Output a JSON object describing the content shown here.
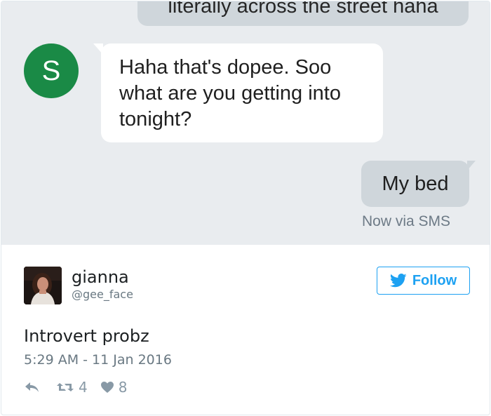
{
  "sms": {
    "cut_message": "literally across the street haha",
    "avatar_letter": "S",
    "incoming_message": "Haha that's dopee. Soo what are you getting into tonight?",
    "outgoing_message": "My bed",
    "status": "Now via SMS"
  },
  "tweet": {
    "user_name": "gianna",
    "user_handle": "@gee_face",
    "follow_label": "Follow",
    "text": "Introvert probz",
    "timestamp": "5:29 AM - 11 Jan 2016",
    "retweet_count": "4",
    "like_count": "8"
  },
  "colors": {
    "sms_background": "#e9ecef",
    "outgoing_bubble": "#cfd6db",
    "avatar_green": "#1a8a46",
    "twitter_blue": "#1da1f2",
    "muted_text": "#697882"
  },
  "icons": {
    "follow": "twitter-bird-icon",
    "reply": "reply-icon",
    "retweet": "retweet-icon",
    "like": "heart-icon"
  }
}
